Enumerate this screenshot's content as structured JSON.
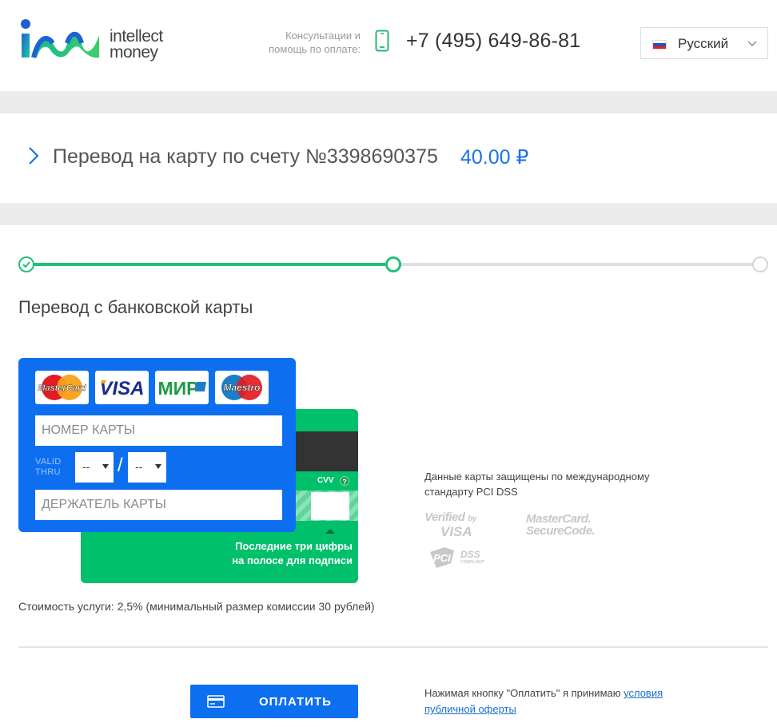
{
  "header": {
    "logo_line1": "intellect",
    "logo_line2": "money",
    "consult_line1": "Консультации и",
    "consult_line2": "помощь по оплате:",
    "phone": "+7 (495) 649-86-81",
    "language": "Русский"
  },
  "invoice": {
    "title": "Перевод на карту по счету №3398690375",
    "amount": "40.00 ₽"
  },
  "progress": {
    "steps_total": 3,
    "current_step": 2
  },
  "form": {
    "section_title": "Перевод с банковской карты",
    "payment_systems": [
      "MasterCard",
      "VISA",
      "МИР",
      "Maestro"
    ],
    "card_number_placeholder": "НОМЕР КАРТЫ",
    "valid_thru_line1": "VALID",
    "valid_thru_line2": "THRU",
    "month_value": "--",
    "year_value": "--",
    "date_separator": "/",
    "holder_placeholder": "ДЕРЖАТЕЛЬ КАРТЫ",
    "cvv_label": "CVV",
    "cvv_help": "?",
    "cvv_hint_line1": "Последние три цифры",
    "cvv_hint_line2": "на полосе для подписи"
  },
  "security": {
    "text": "Данные карты защищены по международному стандарту PCI DSS",
    "logos": {
      "verified_line1": "Verified",
      "verified_by": "by",
      "verified_line2": "VISA",
      "securecode_line1": "MasterCard.",
      "securecode_line2": "SecureCode.",
      "pci": "PCI",
      "dss": "DSS",
      "compliant": "COMPLIANT"
    }
  },
  "fee_text": "Стоимость услуги: 2,5% (минимальный размер комиссии 30 рублей)",
  "pay_button_label": "ОПЛАТИТЬ",
  "terms": {
    "prefix": "Нажимая кнопку \"Оплатить\" я принимаю ",
    "link_line1": "условия",
    "link_line2": "публичной оферты"
  },
  "colors": {
    "brand_blue": "#0d6ff0",
    "green": "#00c06b",
    "progress_green": "#22c07a",
    "progress_gray": "#e0e0e0"
  }
}
